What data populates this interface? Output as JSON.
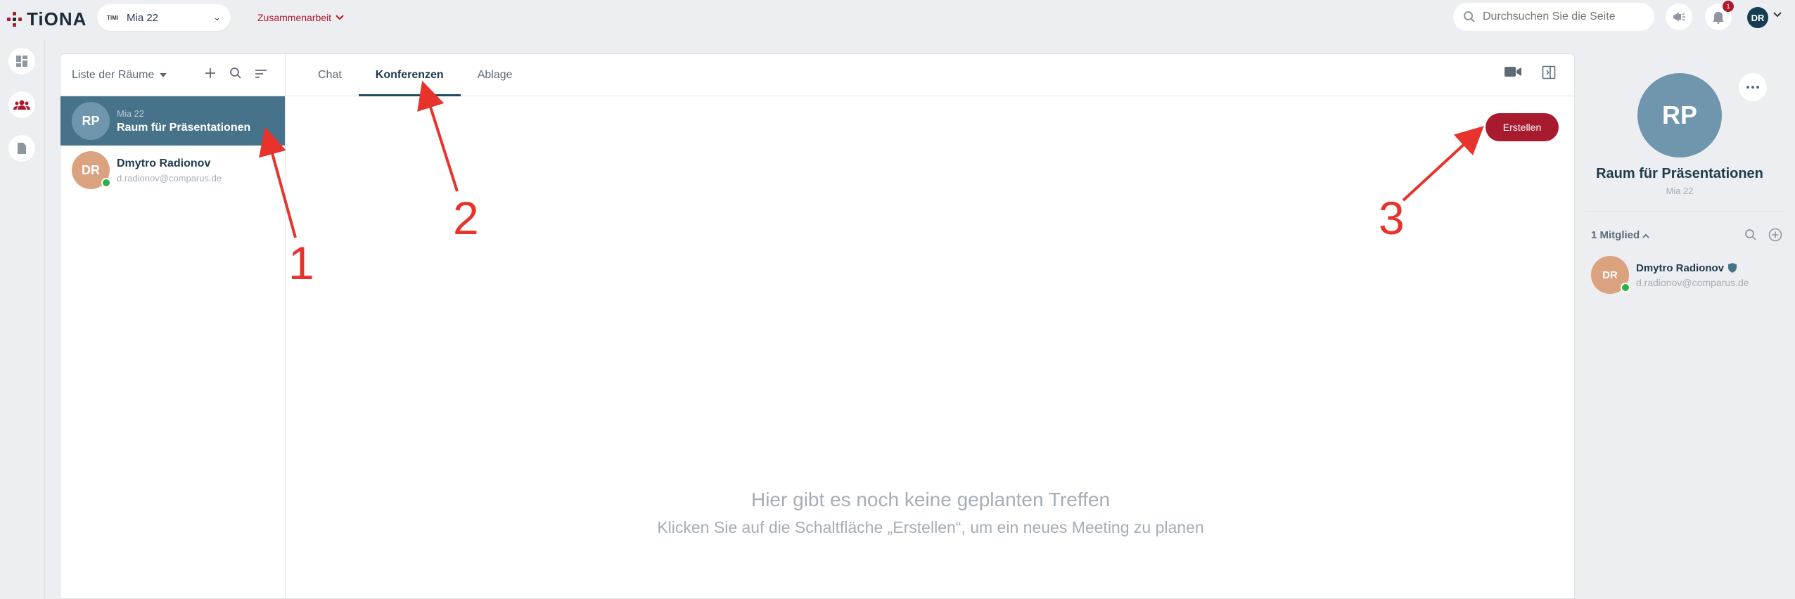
{
  "app": {
    "logo_text": "TiONA"
  },
  "topbar": {
    "company_logo_text": "TIMI",
    "company_name": "Mia 22",
    "nav_collab": "Zusammenarbeit",
    "search_placeholder": "Durchsuchen Sie die Seite",
    "notification_count": "1",
    "user_initials": "DR"
  },
  "rooms": {
    "title": "Liste der Räume",
    "items": [
      {
        "initials": "RP",
        "subtitle": "Mia 22",
        "name": "Raum für Präsentationen",
        "color": "#6f96ad"
      },
      {
        "initials": "DR",
        "name": "Dmytro Radionov",
        "subtitle": "d.radionov@comparus.de",
        "color": "#dba27f"
      }
    ]
  },
  "tabs": [
    {
      "label": "Chat"
    },
    {
      "label": "Konferenzen"
    },
    {
      "label": "Ablage"
    }
  ],
  "main": {
    "create_button": "Erstellen",
    "empty_title": "Hier gibt es noch keine geplanten Treffen",
    "empty_subtitle": "Klicken Sie auf die Schaltfläche „Erstellen“, um ein neues Meeting zu planen"
  },
  "details": {
    "initials": "RP",
    "name": "Raum für Präsentationen",
    "subtitle": "Mia 22",
    "members_title": "1 Mitglied",
    "member": {
      "initials": "DR",
      "name": "Dmytro Radionov",
      "email": "d.radionov@comparus.de"
    }
  },
  "annotations": [
    "1",
    "2",
    "3"
  ],
  "colors": {
    "accent": "#a81a2e",
    "active_room": "#47738a",
    "arrow": "#e8332c",
    "online": "#29b342"
  }
}
